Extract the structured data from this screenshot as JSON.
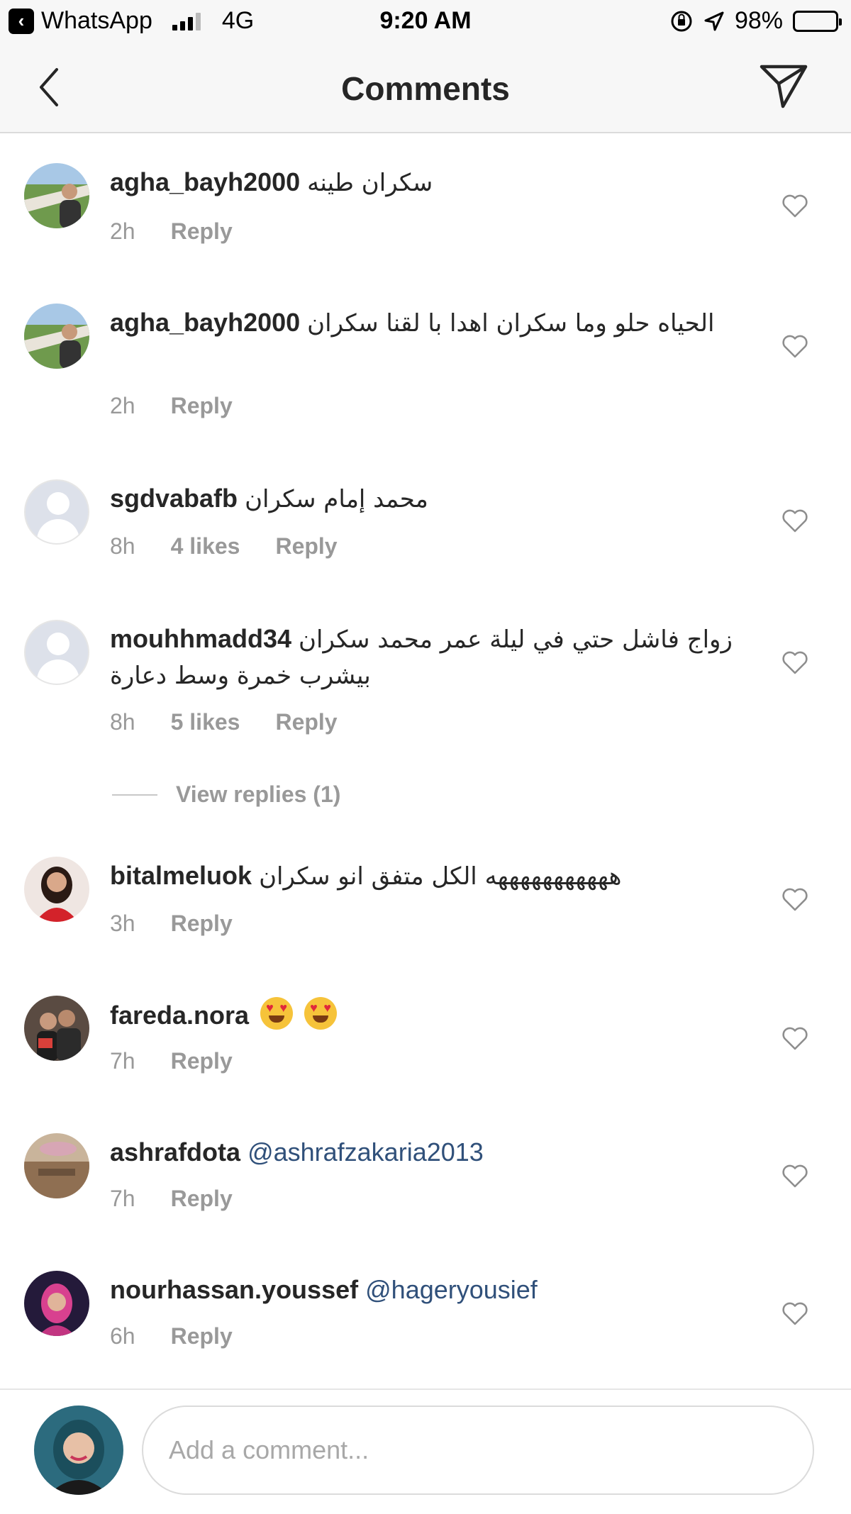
{
  "status_bar": {
    "back_app": "WhatsApp",
    "network": "4G",
    "time": "9:20 AM",
    "battery": "98%",
    "battery_level": 0.98
  },
  "header": {
    "title": "Comments"
  },
  "comments": [
    {
      "user": "agha_bayh2000",
      "text": "سكران طينه",
      "time": "2h",
      "likes": "",
      "reply": "Reply"
    },
    {
      "user": "agha_bayh2000",
      "text": "الحياه حلو وما سكران اهدا با لقنا سكران",
      "time": "2h",
      "likes": "",
      "reply": "Reply"
    },
    {
      "user": "sgdvabafb",
      "text": "محمد إمام سكران",
      "time": "8h",
      "likes": "4 likes",
      "reply": "Reply"
    },
    {
      "user": "mouhhmadd34",
      "text": "زواج فاشل حتي في ليلة عمر محمد سكران بيشرب خمرة وسط دعارة",
      "time": "8h",
      "likes": "5 likes",
      "reply": "Reply"
    },
    {
      "user": "bitalmeluok",
      "text": "هههههههههههه الكل متفق انو سكران",
      "time": "3h",
      "likes": "",
      "reply": "Reply"
    },
    {
      "user": "fareda.nora",
      "text": "",
      "time": "7h",
      "likes": "",
      "reply": "Reply"
    },
    {
      "user": "ashrafdota",
      "text": "@ashrafzakaria2013",
      "time": "7h",
      "likes": "",
      "reply": "Reply"
    },
    {
      "user": "nourhassan.youssef",
      "text": "@hageryousief",
      "time": "6h",
      "likes": "",
      "reply": "Reply"
    }
  ],
  "view_replies": "View replies (1)",
  "footer": {
    "placeholder": "Add a comment..."
  },
  "colors": {
    "mention": "#30507a",
    "meta": "#999999",
    "header_bg": "#f7f7f7"
  }
}
